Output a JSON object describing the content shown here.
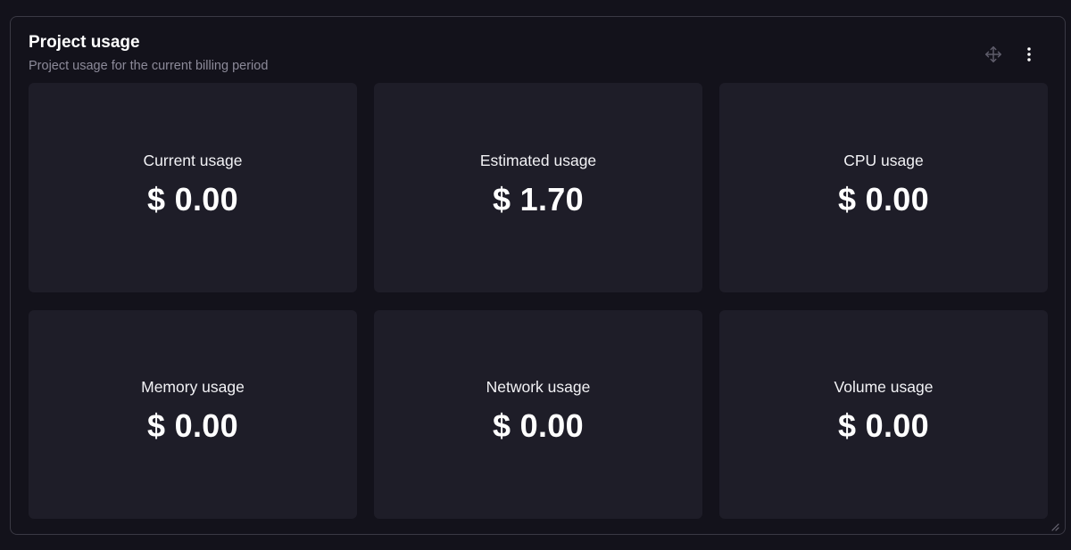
{
  "widget": {
    "title": "Project usage",
    "subtitle": "Project usage for the current billing period",
    "icons": {
      "move": "move-arrows-icon",
      "menu": "kebab-menu-icon",
      "resize": "resize-grip-icon"
    }
  },
  "cards": [
    {
      "label": "Current usage",
      "value": "$ 0.00"
    },
    {
      "label": "Estimated usage",
      "value": "$ 1.70"
    },
    {
      "label": "CPU usage",
      "value": "$ 0.00"
    },
    {
      "label": "Memory usage",
      "value": "$ 0.00"
    },
    {
      "label": "Network usage",
      "value": "$ 0.00"
    },
    {
      "label": "Volume usage",
      "value": "$ 0.00"
    }
  ],
  "colors": {
    "background": "#13121b",
    "card": "#1e1d28",
    "border": "#3a3944",
    "subtitle": "#8c8a99",
    "muted_icon": "#5e5c6a"
  }
}
